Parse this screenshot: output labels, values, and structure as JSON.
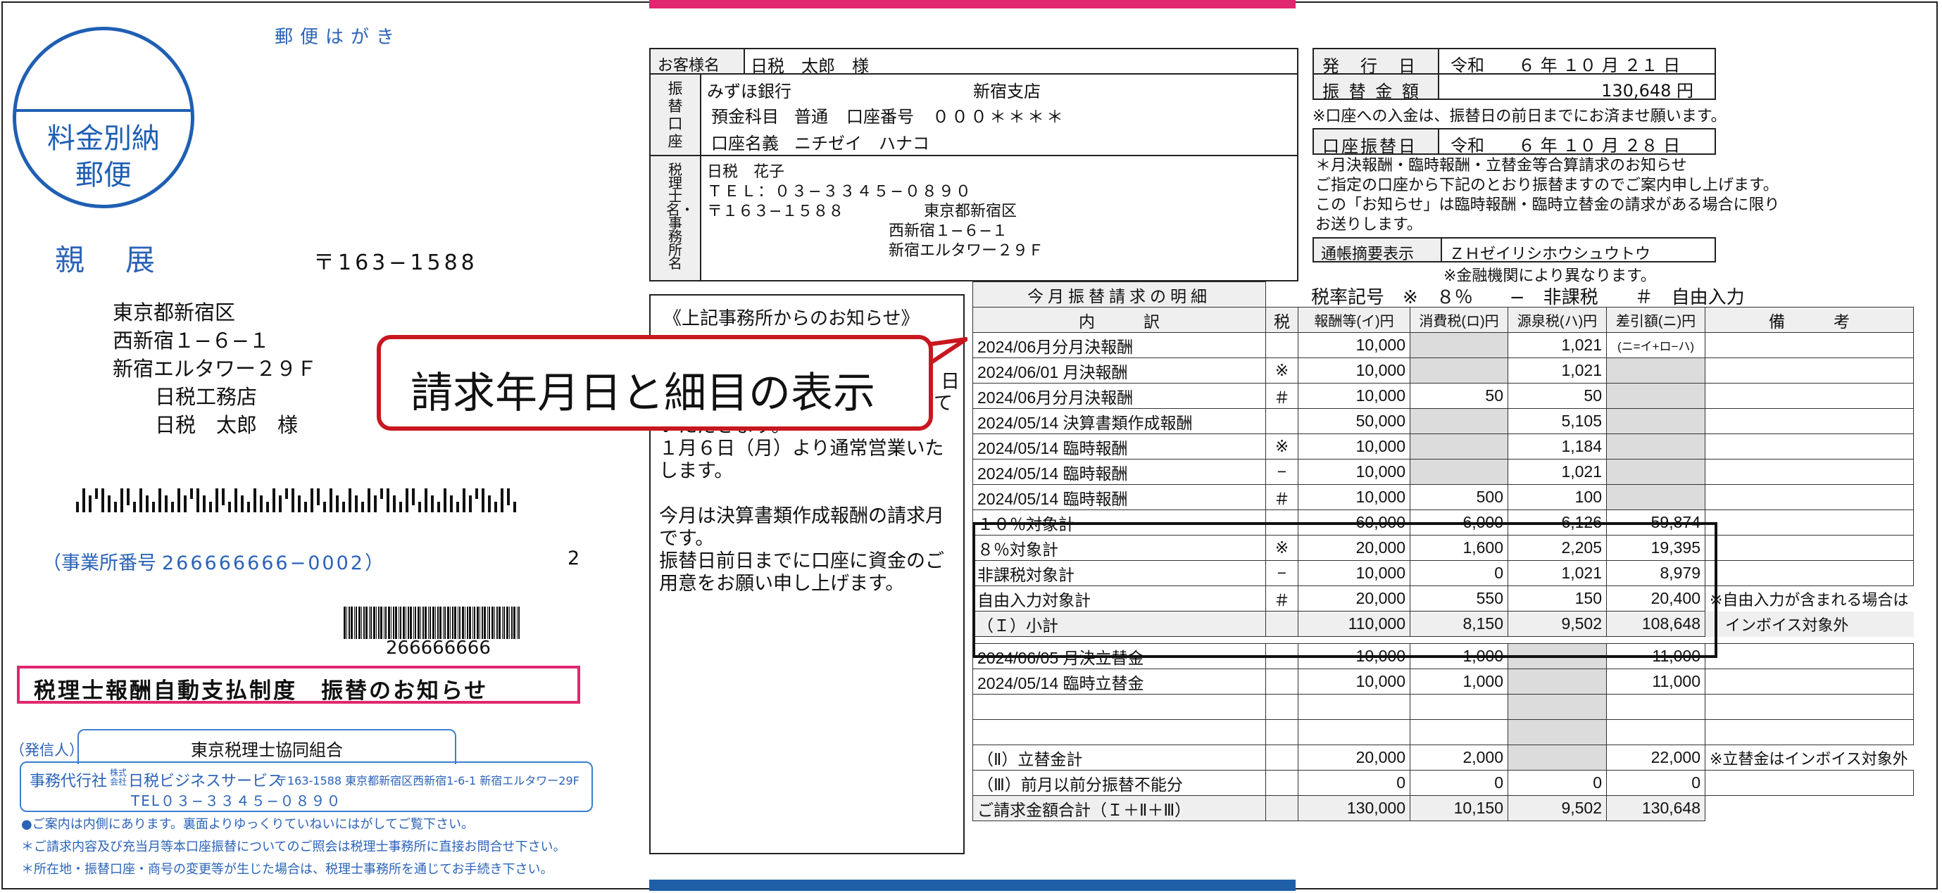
{
  "left": {
    "postcard_label": "郵便はがき",
    "stamp_line1": "料金別納",
    "stamp_line2": "郵便",
    "confidential": "親　展",
    "postal_code": "〒163−1588",
    "address_lines": [
      "東京都新宿区",
      "西新宿１−６−１",
      "新宿エルタワー２９Ｆ",
      "日税工務店",
      "日税　太郎　様"
    ],
    "office_label": "（事業所番号",
    "office_number": "266666666−0002）",
    "office_count": "2",
    "barcode_number": "266666666",
    "notice_title": "税理士報酬自動支払制度　振替のお知らせ",
    "sender_tag": "（発信人）",
    "sender_org": "東京税理士協同組合",
    "agency_label": "事務代行社",
    "agency_small": "株式会社",
    "agency_name": "日税ビジネスサービス",
    "agency_addr": "〒163-1588 東京都新宿区西新宿1-6-1 新宿エルタワー29F",
    "agency_tel": "TEL０３−３３４５−０８９０",
    "notes": [
      "●ご案内は内側にあります。裏面よりゆっくりていねいにはがしてご覧下さい。",
      "＊ご請求内容及び充当月等本口座振替についてのご照会は税理士事務所に直接お問合せ下さい。",
      "＊所在地・振替口座・商号の変更等が生じた場合は、税理士事務所を通じてお手続き下さい。"
    ]
  },
  "customer": {
    "label": "お客様名",
    "value": "日税　太郎　様"
  },
  "account": {
    "label": "振替口座",
    "bank": "みずほ銀行",
    "branch": "新宿支店",
    "deposit_label": "預金科目",
    "deposit_type": "普通",
    "account_no_label": "口座番号",
    "account_no": "０００＊＊＊＊",
    "holder_label": "口座名義",
    "holder": "ニチゼイ　ハナコ"
  },
  "tax_office": {
    "label": "税理士名・事務所名",
    "name": "日税　花子",
    "tel": "ＴＥＬ：０３−３３４５−０８９０",
    "postal": "〒１６３−１５８８",
    "addr1": "東京都新宿区",
    "addr2": "西新宿１−６−１",
    "addr3": "新宿エルタワー２９Ｆ"
  },
  "issue": {
    "issue_label": "発　行　日",
    "issue_date": "令和　　６ 年 １０ 月 ２１ 日",
    "amount_label": "振 替 金 額",
    "amount": "130,648 円",
    "amount_note": "※口座への入金は、振替日の前日までにお済ませ願います。",
    "transfer_label": "口座振替日",
    "transfer_date": "令和　　６ 年 １０ 月 ２８ 日",
    "notice1": "＊月決報酬・臨時報酬・立替金等合算請求のお知らせ",
    "notice2": "ご指定の口座から下記のとおり振替ますのでご案内申し上げます。",
    "notice3": "この「お知らせ」は臨時報酬・臨時立替金の請求がある場合に限り",
    "notice4": "お送りします。",
    "memo_label": "通帳摘要表示",
    "memo_value": "ＺＨゼイリシホウシュウトウ",
    "memo_note": "※金融機関により異なります。"
  },
  "message": {
    "title": "《上記事務所からのお知らせ》",
    "body_lines": [
      "て",
      "いただきます。",
      "１月６日（月）より通常営業いた",
      "します。",
      "",
      "今月は決算書類作成報酬の請求月",
      "です。",
      "振替日前日までに口座に資金のご",
      "用意をお願い申し上げます。"
    ],
    "body_overflow": "日"
  },
  "callout": "請求年月日と細目の表示",
  "detail": {
    "section_title": "今月振替請求の明細",
    "tax_legend": "税率記号　※　８％　　−　非課税　　＃　自由入力",
    "headers": [
      "内　　　訳",
      "税",
      "報酬等(イ)円",
      "消費税(ロ)円",
      "源泉税(ハ)円",
      "差引額(ニ)円",
      "備　　　考"
    ],
    "rows": [
      {
        "item": "2024/06月分月決報酬",
        "tax": "",
        "fee": "10,000",
        "ctax": "",
        "wtax": "1,021",
        "net": "(ニ=イ+ロ−ハ)",
        "note": ""
      },
      {
        "item": "2024/06/01 月決報酬",
        "tax": "※",
        "fee": "10,000",
        "ctax": "",
        "wtax": "1,021",
        "net": "",
        "note": ""
      },
      {
        "item": "2024/06月分月決報酬",
        "tax": "＃",
        "fee": "10,000",
        "ctax": "50",
        "wtax": "50",
        "net": "",
        "note": ""
      },
      {
        "item": "2024/05/14 決算書類作成報酬",
        "tax": "",
        "fee": "50,000",
        "ctax": "",
        "wtax": "5,105",
        "net": "",
        "note": ""
      },
      {
        "item": "2024/05/14 臨時報酬",
        "tax": "※",
        "fee": "10,000",
        "ctax": "",
        "wtax": "1,184",
        "net": "",
        "note": ""
      },
      {
        "item": "2024/05/14 臨時報酬",
        "tax": "−",
        "fee": "10,000",
        "ctax": "",
        "wtax": "1,021",
        "net": "",
        "note": ""
      },
      {
        "item": "2024/05/14 臨時報酬",
        "tax": "＃",
        "fee": "10,000",
        "ctax": "500",
        "wtax": "100",
        "net": "",
        "note": ""
      }
    ],
    "subtotals": [
      {
        "item": "１０％対象計",
        "tax": "",
        "fee": "60,000",
        "ctax": "6,000",
        "wtax": "6,126",
        "net": "59,874",
        "note": ""
      },
      {
        "item": "８％対象計",
        "tax": "※",
        "fee": "20,000",
        "ctax": "1,600",
        "wtax": "2,205",
        "net": "19,395",
        "note": ""
      },
      {
        "item": "非課税対象計",
        "tax": "−",
        "fee": "10,000",
        "ctax": "0",
        "wtax": "1,021",
        "net": "8,979",
        "note": ""
      },
      {
        "item": "自由入力対象計",
        "tax": "＃",
        "fee": "20,000",
        "ctax": "550",
        "wtax": "150",
        "net": "20,400",
        "note": "※自由入力が含まれる場合は"
      },
      {
        "item": "（Ｉ）小計",
        "tax": "",
        "fee": "110,000",
        "ctax": "8,150",
        "wtax": "9,502",
        "net": "108,648",
        "note": "　インボイス対象外"
      }
    ],
    "advances": [
      {
        "item": "2024/06/05 月決立替金",
        "fee": "10,000",
        "ctax": "1,000",
        "wtax": "",
        "net": "11,000",
        "note": ""
      },
      {
        "item": "2024/05/14 臨時立替金",
        "fee": "10,000",
        "ctax": "1,000",
        "wtax": "",
        "net": "11,000",
        "note": ""
      },
      {
        "item": "",
        "fee": "",
        "ctax": "",
        "wtax": "",
        "net": "",
        "note": ""
      },
      {
        "item": "",
        "fee": "",
        "ctax": "",
        "wtax": "",
        "net": "",
        "note": ""
      }
    ],
    "totals": [
      {
        "item": "（Ⅱ）立替金計",
        "fee": "20,000",
        "ctax": "2,000",
        "wtax": "",
        "net": "22,000",
        "note": "※立替金はインボイス対象外"
      },
      {
        "item": "（Ⅲ）前月以前分振替不能分",
        "fee": "0",
        "ctax": "0",
        "wtax": "0",
        "net": "0",
        "note": ""
      },
      {
        "item": "ご請求金額合計（Ｉ＋Ⅱ＋Ⅲ）",
        "fee": "130,000",
        "ctax": "10,150",
        "wtax": "9,502",
        "net": "130,648",
        "note": ""
      }
    ]
  }
}
